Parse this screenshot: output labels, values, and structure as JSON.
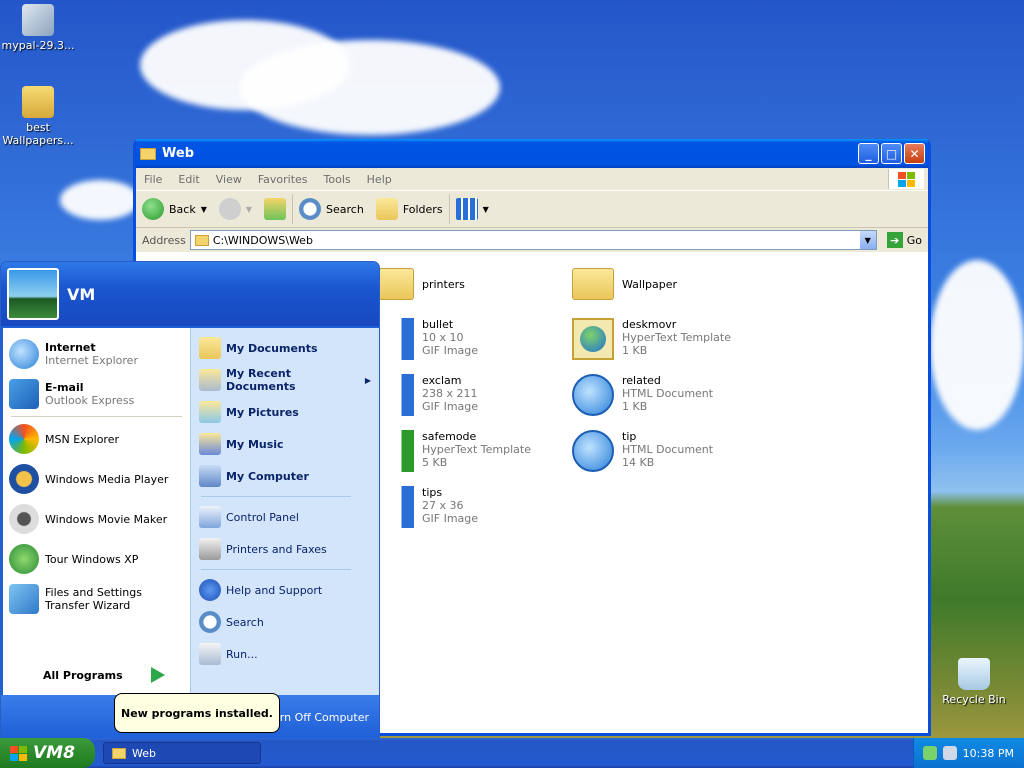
{
  "desktop": {
    "icons": [
      {
        "label": "mypal-29.3...",
        "icon": "cd-installer-icon"
      },
      {
        "label": "best Wallpapers...",
        "icon": "zip-folder-icon"
      },
      {
        "label": "Recycle Bin",
        "icon": "recycle-bin-icon"
      }
    ]
  },
  "window": {
    "title": "Web",
    "menu": [
      "File",
      "Edit",
      "View",
      "Favorites",
      "Tools",
      "Help"
    ],
    "toolbar": {
      "back": "Back",
      "search": "Search",
      "folders": "Folders"
    },
    "address_label": "Address",
    "address_value": "C:\\WINDOWS\\Web",
    "go_label": "Go",
    "files": [
      {
        "name": "printers",
        "detail1": "",
        "detail2": "",
        "icon": "folder-icon"
      },
      {
        "name": "Wallpaper",
        "detail1": "",
        "detail2": "",
        "icon": "folder-icon"
      },
      {
        "name": "bullet",
        "detail1": "10 x 10",
        "detail2": "GIF Image",
        "icon": "gif-image-icon"
      },
      {
        "name": "deskmovr",
        "detail1": "HyperText Template",
        "detail2": "1 KB",
        "icon": "globe-template-icon"
      },
      {
        "name": "exclam",
        "detail1": "238 x 211",
        "detail2": "GIF Image",
        "icon": "gif-image-icon"
      },
      {
        "name": "related",
        "detail1": "HTML Document",
        "detail2": "1 KB",
        "icon": "ie-document-icon"
      },
      {
        "name": "safemode",
        "detail1": "HyperText Template",
        "detail2": "5 KB",
        "icon": "globe-template-icon"
      },
      {
        "name": "tip",
        "detail1": "HTML Document",
        "detail2": "14 KB",
        "icon": "ie-document-icon"
      },
      {
        "name": "tips",
        "detail1": "27 x 36",
        "detail2": "GIF Image",
        "icon": "gif-image-icon"
      }
    ]
  },
  "start_menu": {
    "user": "VM",
    "pinned": [
      {
        "title": "Internet",
        "sub": "Internet Explorer"
      },
      {
        "title": "E-mail",
        "sub": "Outlook Express"
      }
    ],
    "recent": [
      "MSN Explorer",
      "Windows Media Player",
      "Windows Movie Maker",
      "Tour Windows XP",
      "Files and Settings Transfer Wizard"
    ],
    "all_programs": "All Programs",
    "right_bold": [
      "My Documents",
      "My Recent Documents",
      "My Pictures",
      "My Music",
      "My Computer"
    ],
    "right_mid": [
      "Control Panel",
      "Printers and Faxes"
    ],
    "right_low": [
      "Help and Support",
      "Search",
      "Run..."
    ],
    "turn_off": "Turn Off Computer"
  },
  "balloon": "New programs installed.",
  "taskbar": {
    "start_label": "VM8",
    "task": "Web",
    "clock": "10:38 PM"
  }
}
